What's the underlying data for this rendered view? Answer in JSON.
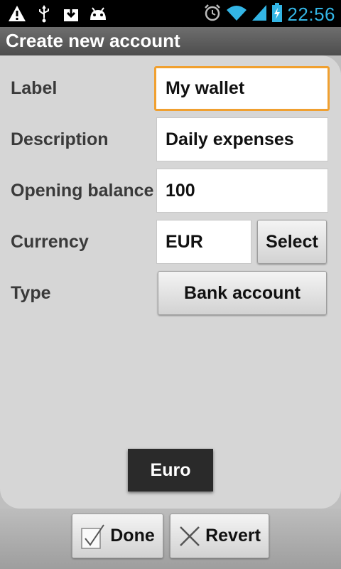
{
  "status_bar": {
    "time": "22:56",
    "icons": [
      "warning-icon",
      "usb-icon",
      "download-icon",
      "android-icon",
      "alarm-icon",
      "wifi-icon",
      "signal-icon",
      "battery-charging-icon"
    ],
    "accent_color": "#33b5e5"
  },
  "title": "Create new account",
  "form": {
    "label": {
      "caption": "Label",
      "value": "My wallet"
    },
    "description": {
      "caption": "Description",
      "value": "Daily expenses"
    },
    "opening_balance": {
      "caption": "Opening balance",
      "value": "100"
    },
    "currency": {
      "caption": "Currency",
      "value": "EUR",
      "select_label": "Select"
    },
    "type": {
      "caption": "Type",
      "value": "Bank account"
    }
  },
  "toast": "Euro",
  "actions": {
    "done_label": "Done",
    "revert_label": "Revert"
  },
  "colors": {
    "focus_border": "#f0a030"
  }
}
